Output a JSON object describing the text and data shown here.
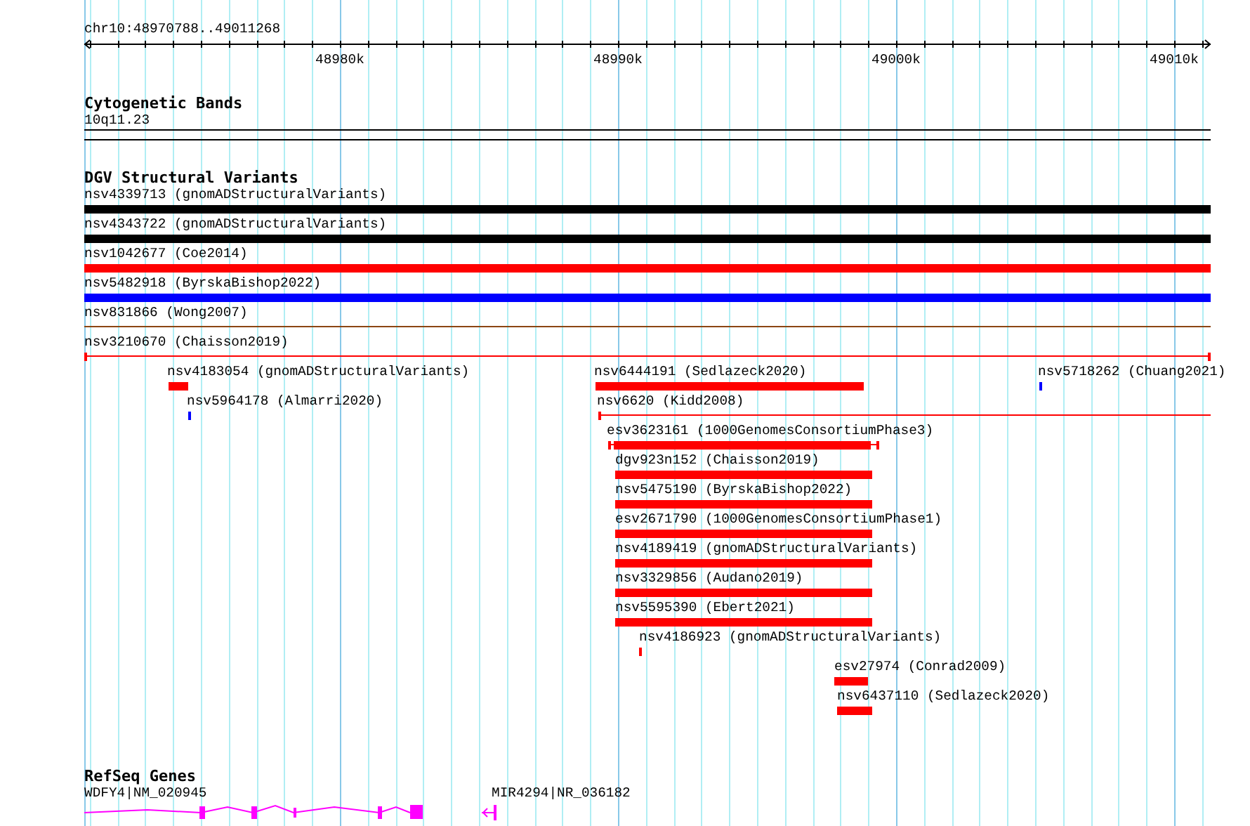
{
  "ruler": {
    "position": "chr10:48970788..49011268",
    "ticks": [
      "48980k",
      "48990k",
      "49000k",
      "49010k"
    ]
  },
  "tracks": [
    {
      "title": "Cytogenetic Bands",
      "kind": "bands",
      "features": [
        {
          "label": "10q11.23"
        }
      ]
    },
    {
      "title": "DGV Structural Variants",
      "kind": "variants",
      "features": [
        {
          "label": "nsv4339713 (gnomADStructuralVariants)",
          "color": "#000000",
          "kind": "bar"
        },
        {
          "label": "nsv4343722 (gnomADStructuralVariants)",
          "color": "#000000",
          "kind": "bar"
        },
        {
          "label": "nsv1042677 (Coe2014)",
          "color": "#ff0000",
          "kind": "bar"
        },
        {
          "label": "nsv5482918 (ByrskaBishop2022)",
          "color": "#0000ff",
          "kind": "bar"
        },
        {
          "label": "nsv831866 (Wong2007)",
          "color": "#8b4513",
          "kind": "line"
        },
        {
          "label": "nsv3210670 (Chaisson2019)",
          "color": "#ff0000",
          "kind": "line"
        },
        {
          "label": "nsv4183054 (gnomADStructuralVariants)",
          "color": "#ff0000",
          "kind": "bar"
        },
        {
          "label": "nsv6444191 (Sedlazeck2020)",
          "color": "#ff0000",
          "kind": "bar"
        },
        {
          "label": "nsv5718262 (Chuang2021)",
          "color": "#0000ff",
          "kind": "bar"
        },
        {
          "label": "nsv5964178 (Almarri2020)",
          "color": "#0000ff",
          "kind": "bar"
        },
        {
          "label": "nsv6620 (Kidd2008)",
          "color": "#ff0000",
          "kind": "line"
        },
        {
          "label": "esv3623161 (1000GenomesConsortiumPhase3)",
          "color": "#ff0000",
          "kind": "whisker"
        },
        {
          "label": "dgv923n152 (Chaisson2019)",
          "color": "#ff0000",
          "kind": "bar"
        },
        {
          "label": "nsv5475190 (ByrskaBishop2022)",
          "color": "#ff0000",
          "kind": "bar"
        },
        {
          "label": "esv2671790 (1000GenomesConsortiumPhase1)",
          "color": "#ff0000",
          "kind": "bar"
        },
        {
          "label": "nsv4189419 (gnomADStructuralVariants)",
          "color": "#ff0000",
          "kind": "bar"
        },
        {
          "label": "nsv3329856 (Audano2019)",
          "color": "#ff0000",
          "kind": "bar"
        },
        {
          "label": "nsv5595390 (Ebert2021)",
          "color": "#ff0000",
          "kind": "bar"
        },
        {
          "label": "nsv4186923 (gnomADStructuralVariants)",
          "color": "#ff0000",
          "kind": "bar"
        },
        {
          "label": "esv27974 (Conrad2009)",
          "color": "#ff0000",
          "kind": "bar"
        },
        {
          "label": "nsv6437110 (Sedlazeck2020)",
          "color": "#ff0000",
          "kind": "bar"
        }
      ]
    },
    {
      "title": "RefSeq Genes",
      "kind": "genes",
      "features": [
        {
          "label": "WDFY4|NM_020945"
        },
        {
          "label": "MIR4294|NR_036182"
        }
      ]
    }
  ]
}
